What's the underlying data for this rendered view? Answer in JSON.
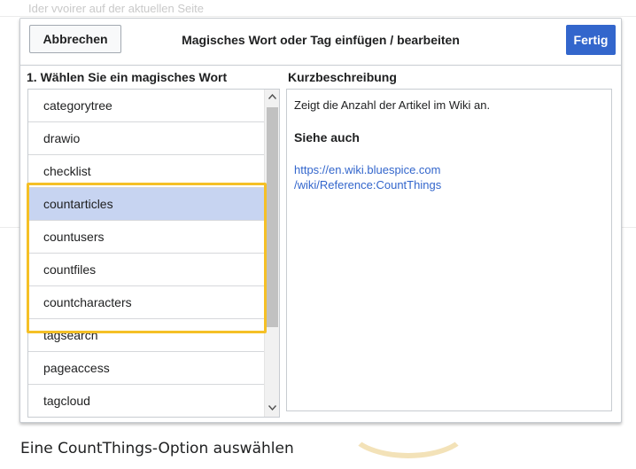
{
  "background": {
    "faded_text": "Ider vvoirer auf der aktuellen Seite"
  },
  "dialog": {
    "title": "Magisches Wort oder Tag einfügen / bearbeiten",
    "cancel_label": "Abbrechen",
    "done_label": "Fertig",
    "left_heading": "1. Wählen Sie ein magisches Wort",
    "right_heading": "Kurzbeschreibung",
    "list": {
      "items": [
        "categorytree",
        "drawio",
        "checklist",
        "countarticles",
        "countusers",
        "countfiles",
        "countcharacters",
        "tagsearch",
        "pageaccess",
        "tagcloud"
      ],
      "selected": "countarticles"
    },
    "description": {
      "text": "Zeigt die Anzahl der Artikel im Wiki an.",
      "see_also_label": "Siehe auch",
      "link_line1": "https://en.wiki.bluespice.com",
      "link_line2": "/wiki/Reference:CountThings"
    }
  },
  "caption": "Eine CountThings-Option auswählen",
  "colors": {
    "accent": "#3366cc",
    "selection": "#c7d4f1",
    "highlight_frame": "#f5c026"
  },
  "icons": {
    "scroll_up": "chevron-up-icon",
    "scroll_down": "chevron-down-icon"
  }
}
